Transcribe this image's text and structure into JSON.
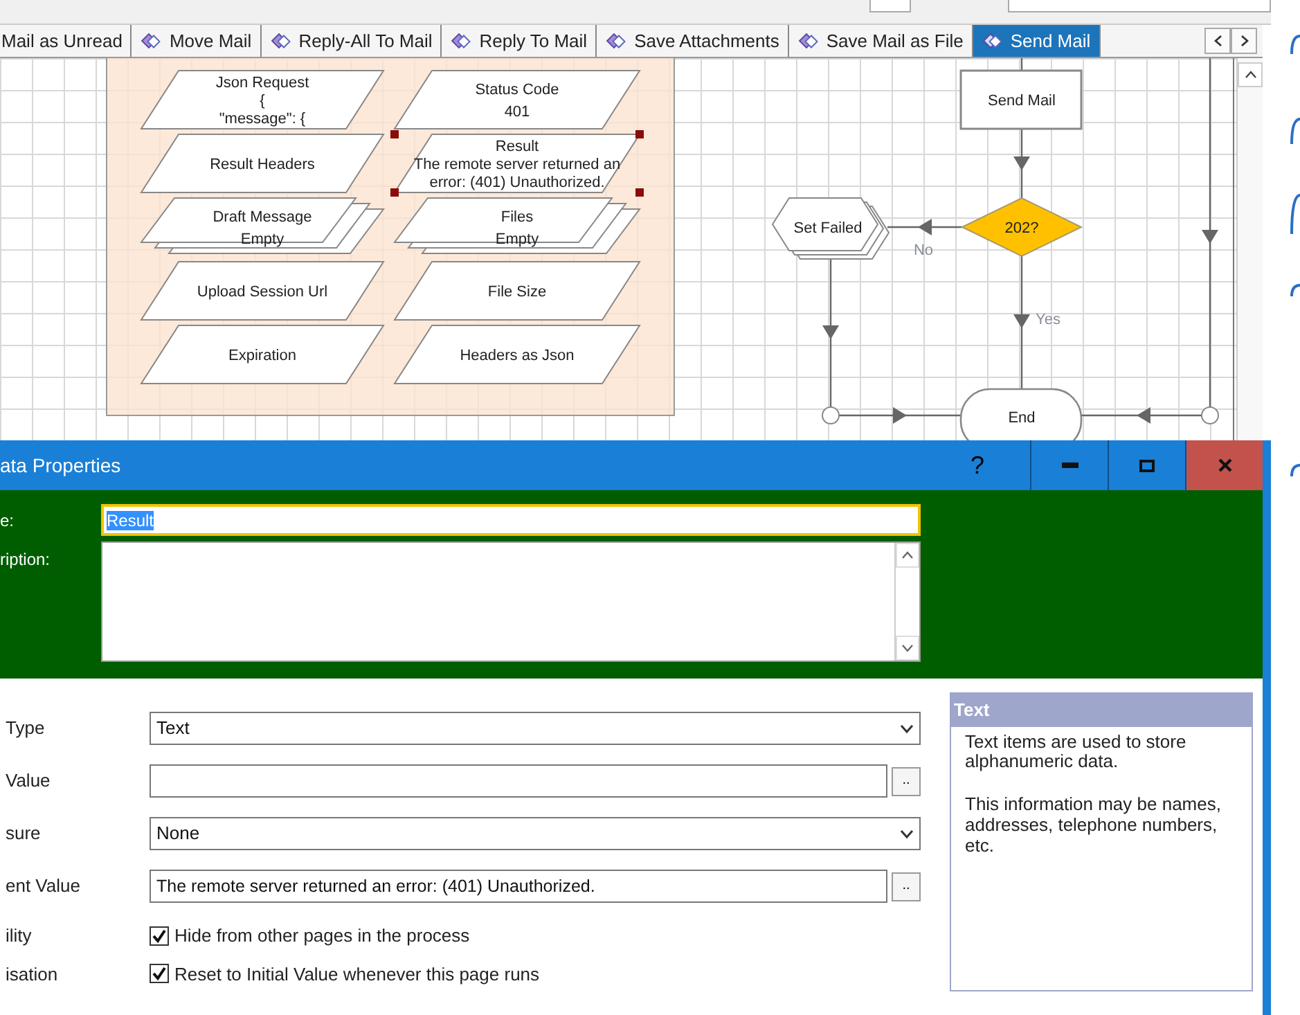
{
  "tabs": [
    {
      "label": "Mail as Unread",
      "selected": false
    },
    {
      "label": "Move Mail",
      "selected": false
    },
    {
      "label": "Reply-All To Mail",
      "selected": false
    },
    {
      "label": "Reply To Mail",
      "selected": false
    },
    {
      "label": "Save Attachments",
      "selected": false
    },
    {
      "label": "Save Mail as File",
      "selected": false
    },
    {
      "label": "Send Mail",
      "selected": true
    }
  ],
  "diagram": {
    "data_items": [
      {
        "kind": "single",
        "lines": [
          "Json Request",
          "{",
          "\"message\": {"
        ],
        "selected": false
      },
      {
        "kind": "single",
        "lines": [
          "Result Headers"
        ],
        "selected": false
      },
      {
        "kind": "collection",
        "lines": [
          "Draft Message",
          "Empty"
        ],
        "selected": false
      },
      {
        "kind": "single",
        "lines": [
          "Upload Session Url"
        ],
        "selected": false
      },
      {
        "kind": "single",
        "lines": [
          "Expiration"
        ],
        "selected": false
      },
      {
        "kind": "single",
        "lines": [
          "Status Code",
          "401"
        ],
        "selected": false
      },
      {
        "kind": "single",
        "lines": [
          "Result",
          "The remote server returned an",
          "error: (401) Unauthorized."
        ],
        "selected": true
      },
      {
        "kind": "collection",
        "lines": [
          "Files",
          "Empty"
        ],
        "selected": false
      },
      {
        "kind": "single",
        "lines": [
          "File Size"
        ],
        "selected": false
      },
      {
        "kind": "single",
        "lines": [
          "Headers as Json"
        ],
        "selected": false
      }
    ],
    "nodes": [
      {
        "kind": "process",
        "label": "Send Mail"
      },
      {
        "kind": "page",
        "label": "Set Failed"
      },
      {
        "kind": "decision",
        "label": "202?"
      },
      {
        "kind": "end",
        "label": "End"
      }
    ],
    "branch_labels": [
      "No",
      "Yes"
    ]
  },
  "dialog": {
    "title": "ata Properties",
    "help": "?",
    "name_label": "e:",
    "name_value": "Result",
    "name_text_selected": true,
    "description_label": "ription:",
    "rows": [
      {
        "kind": "dropdown",
        "label": "Type",
        "value": "Text"
      },
      {
        "kind": "browse",
        "label": "Value",
        "button": ".."
      },
      {
        "kind": "dropdown",
        "label": "sure",
        "value": "None"
      },
      {
        "kind": "browse",
        "label": "ent Value",
        "value": "The remote server returned an error: (401) Unauthorized.",
        "button": ".."
      },
      {
        "kind": "checkbox",
        "label": "ility",
        "text": "Hide from other pages in the process",
        "checked": true
      },
      {
        "kind": "checkbox",
        "label": "isation",
        "text": "Reset to Initial Value whenever this page runs",
        "checked": true
      }
    ],
    "info": {
      "title": "Text",
      "paragraphs": [
        "Text items are used to store alphanumeric data.",
        "This information may be names, addresses, telephone numbers, etc."
      ]
    }
  }
}
